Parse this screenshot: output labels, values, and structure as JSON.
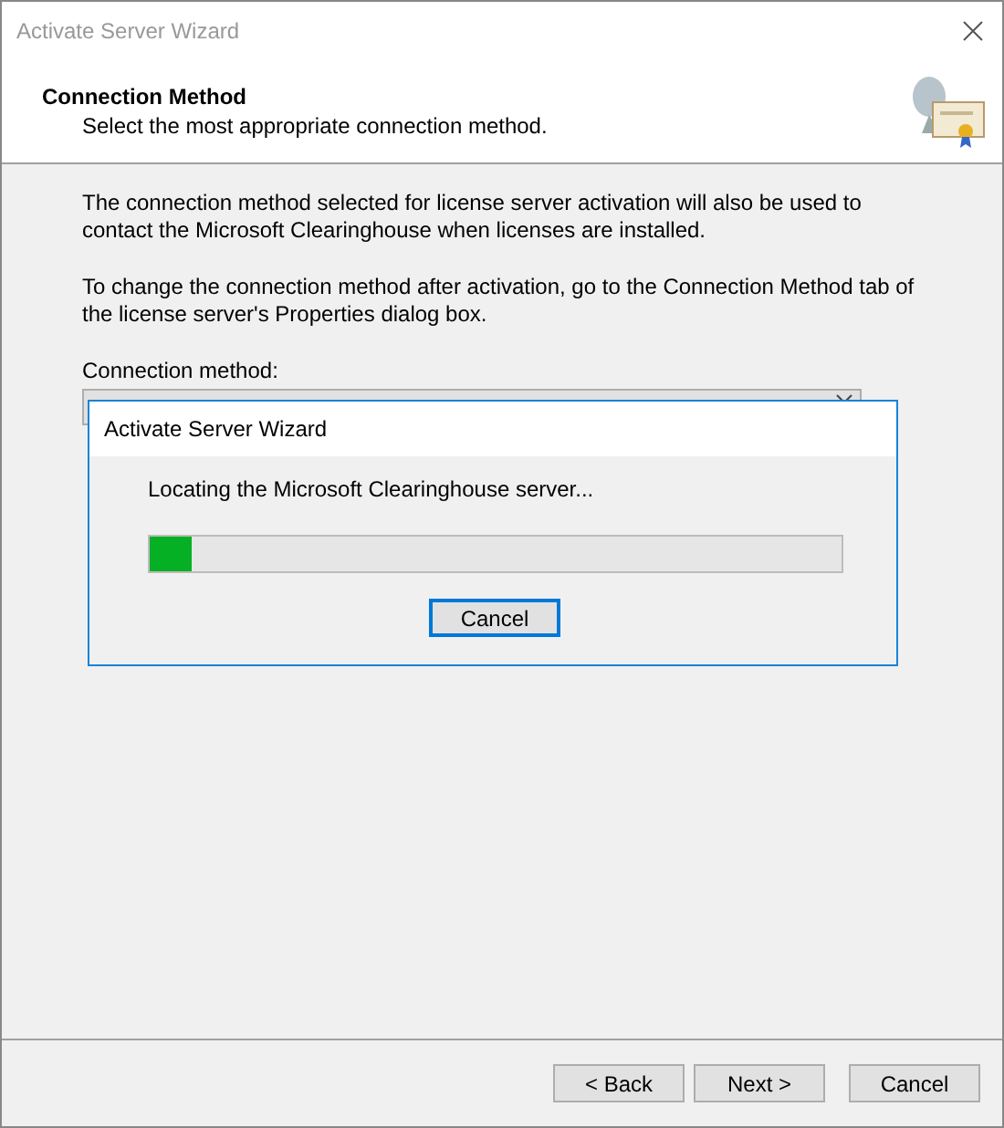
{
  "window": {
    "title": "Activate Server Wizard"
  },
  "header": {
    "title": "Connection Method",
    "subtitle": "Select the most appropriate connection method."
  },
  "paragraphs": [
    "The connection method selected for license server activation will also be used to contact the Microsoft Clearinghouse when licenses are installed.",
    "To change the connection method after activation, go to the Connection Method tab of the license server's Properties dialog box."
  ],
  "connection_method": {
    "label": "Connection method:"
  },
  "progress_dialog": {
    "title": "Activate Server Wizard",
    "message": "Locating the Microsoft Clearinghouse server...",
    "level": 0.06,
    "button": "Cancel"
  },
  "buttons": [
    {
      "label": "< Back",
      "kind": "nav"
    },
    {
      "label": "Next >",
      "kind": "nav"
    },
    {
      "label": "Cancel",
      "kind": "cancel"
    }
  ]
}
